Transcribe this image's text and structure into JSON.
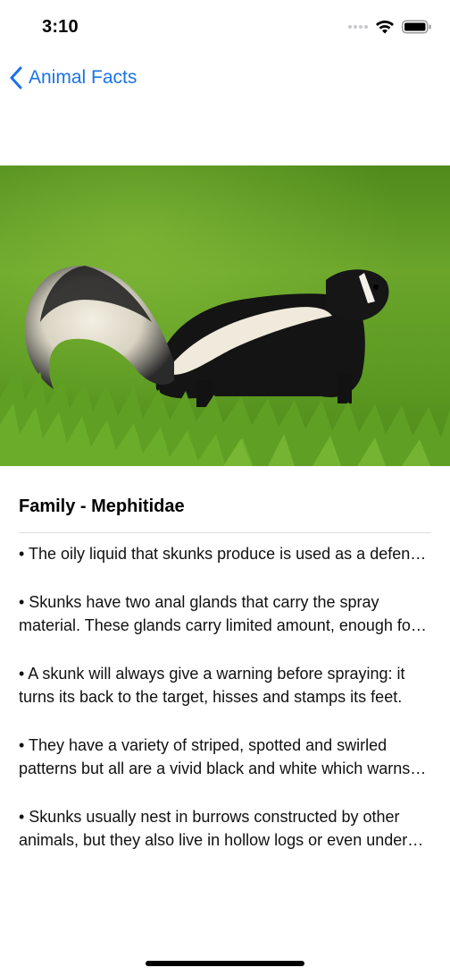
{
  "status_bar": {
    "time": "3:10",
    "icons": [
      "signal-dots-icon",
      "wifi-icon",
      "battery-icon"
    ]
  },
  "nav": {
    "back_label": "Animal Facts",
    "accent_color": "#1a73e8"
  },
  "hero": {
    "image_subject": "skunk-photo"
  },
  "animal": {
    "family": "Family - Mephitidae",
    "facts": [
      "• The oily liquid that skunks produce is used as a defense mechanism against predators.",
      "• Skunks have two anal glands that carry the spray material. These glands carry limited amount, enough for five or six sprays.",
      "• A skunk will always give a warning before spraying: it turns its back to the target, hisses and stamps its feet.",
      "• They have a variety of striped, spotted and swirled patterns but all are a vivid black and white which warns predators.",
      "• Skunks usually nest in burrows constructed by other animals, but they also live in hollow logs or even under houses."
    ]
  }
}
